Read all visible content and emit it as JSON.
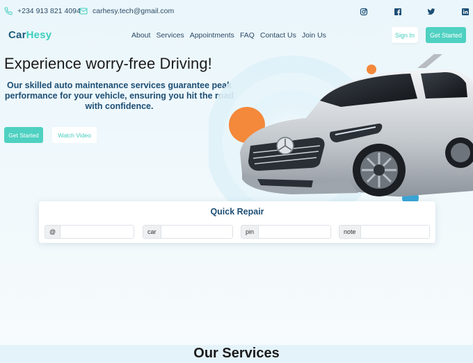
{
  "contact": {
    "phone": "+234 913 821 4094",
    "email": "carhesy.tech@gmail.com"
  },
  "social": [
    "instagram-icon",
    "facebook-icon",
    "twitter-icon",
    "linkedin-icon"
  ],
  "brand": {
    "part1": "Car",
    "part2": "Hesy"
  },
  "nav": {
    "items": [
      "About",
      "Services",
      "Appointments",
      "FAQ",
      "Contact Us",
      "Join Us"
    ],
    "sign_in": "Sign In",
    "get_started": "Get Started"
  },
  "hero": {
    "title": "Experience worry-free Driving!",
    "subtitle": "Our skilled auto maintenance services guarantee peak performance for your vehicle, ensuring you hit the road with confidence.",
    "get_started": "Get Started",
    "watch_video": "Watch Video"
  },
  "quick_repair": {
    "title": "Quick Repair",
    "fields": [
      {
        "addon": "@",
        "value": ""
      },
      {
        "addon": "car",
        "value": ""
      },
      {
        "addon": "pin",
        "value": ""
      },
      {
        "addon": "note",
        "value": ""
      }
    ]
  },
  "services": {
    "title": "Our Services"
  },
  "colors": {
    "accent": "#4fd1c1",
    "brand_dark": "#1d5b79",
    "heading_blue": "#1d4e74",
    "orange": "#f4883b",
    "background": "#eaf6fb"
  }
}
